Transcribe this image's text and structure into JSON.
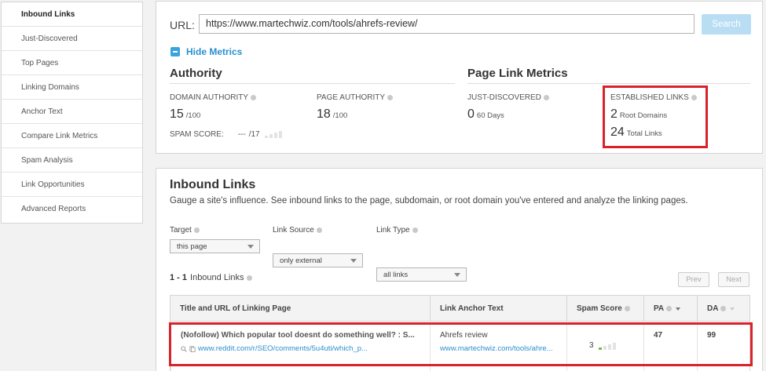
{
  "sidebar": {
    "items": [
      {
        "label": "Inbound Links"
      },
      {
        "label": "Just-Discovered"
      },
      {
        "label": "Top Pages"
      },
      {
        "label": "Linking Domains"
      },
      {
        "label": "Anchor Text"
      },
      {
        "label": "Compare Link Metrics"
      },
      {
        "label": "Spam Analysis"
      },
      {
        "label": "Link Opportunities"
      },
      {
        "label": "Advanced Reports"
      }
    ]
  },
  "search": {
    "url_label": "URL:",
    "url_value": "https://www.martechwiz.com/tools/ahrefs-review/",
    "button_label": "Search"
  },
  "metrics": {
    "toggle_label": "Hide Metrics",
    "authority": {
      "title": "Authority",
      "domain_authority_label": "DOMAIN AUTHORITY",
      "domain_authority_value": "15",
      "domain_authority_max": "/100",
      "page_authority_label": "PAGE AUTHORITY",
      "page_authority_value": "18",
      "page_authority_max": "/100",
      "spam_score_label": "SPAM SCORE:",
      "spam_score_value": "---",
      "spam_score_max": "/17"
    },
    "page_link": {
      "title": "Page Link Metrics",
      "just_discovered_label": "JUST-DISCOVERED",
      "just_discovered_value": "0",
      "just_discovered_unit": "60 Days",
      "established_label": "ESTABLISHED LINKS",
      "root_domains_value": "2",
      "root_domains_label": "Root Domains",
      "total_links_value": "24",
      "total_links_label": "Total Links"
    }
  },
  "inbound": {
    "title": "Inbound Links",
    "description": "Gauge a site's influence. See inbound links to the page, subdomain, or root domain you've entered and analyze the linking pages.",
    "filters": [
      {
        "label": "Target",
        "value": "this page"
      },
      {
        "label": "Link Source",
        "value": "only external"
      },
      {
        "label": "Link Type",
        "value": "all links"
      }
    ],
    "count_range": "1 - 1",
    "count_label": "Inbound Links",
    "prev_label": "Prev",
    "next_label": "Next",
    "table": {
      "headers": {
        "title_url": "Title and URL of Linking Page",
        "anchor": "Link Anchor Text",
        "spam": "Spam Score",
        "pa": "PA",
        "da": "DA"
      },
      "rows": [
        {
          "title": "(Nofollow) Which popular tool doesnt do something well? : S...",
          "url": "www.reddit.com/r/SEO/comments/5u4uti/which_p...",
          "anchor_text": "Ahrefs review",
          "anchor_url": "www.martechwiz.com/tools/ahre...",
          "spam_score": "3",
          "pa": "47",
          "da": "99"
        }
      ]
    }
  },
  "colors": {
    "accent": "#2a8fd0",
    "highlight_box": "#d8232a",
    "search_button": "#b9def4"
  }
}
